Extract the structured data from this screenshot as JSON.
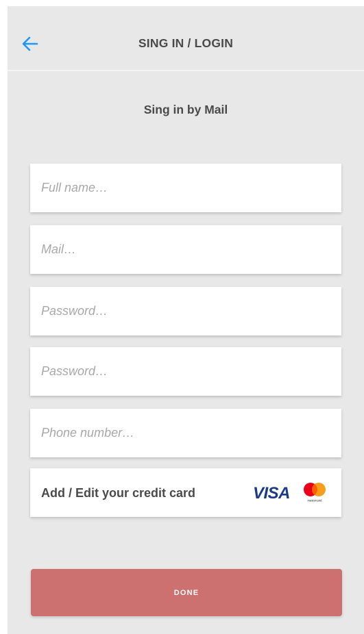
{
  "header": {
    "title": "SING IN / LOGIN",
    "back_icon": "arrow-left-icon",
    "accent_color": "#2196f3"
  },
  "form": {
    "section_title": "Sing in by Mail",
    "fields": [
      {
        "placeholder": "Full name…",
        "value": ""
      },
      {
        "placeholder": "Mail…",
        "value": ""
      },
      {
        "placeholder": "Password…",
        "value": ""
      },
      {
        "placeholder": "Password…",
        "value": ""
      },
      {
        "placeholder": "Phone number…",
        "value": ""
      }
    ],
    "credit_card": {
      "label": "Add / Edit your credit card",
      "visa_text": "VISA",
      "mastercard_text": "mastercard"
    }
  },
  "footer": {
    "done_label": "DONE",
    "button_color": "#cc7070"
  }
}
